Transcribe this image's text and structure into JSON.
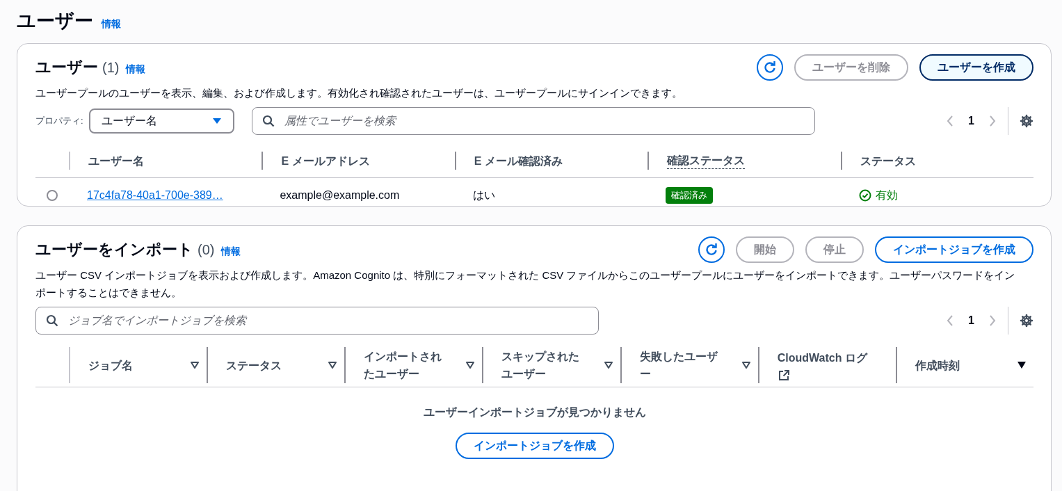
{
  "page": {
    "title": "ユーザー",
    "info": "情報"
  },
  "users": {
    "title": "ユーザー",
    "count": "(1)",
    "info": "情報",
    "buttons": [
      {
        "label": "ユーザーを削除",
        "disabled": true,
        "highlighted": false
      },
      {
        "label": "ユーザーを作成",
        "disabled": false,
        "highlighted": true
      }
    ],
    "description": "ユーザープールのユーザーを表示、編集、および作成します。有効化され確認されたユーザーは、ユーザープールにサインインできます。",
    "property_label": "プロパティ:",
    "property_value": "ユーザー名",
    "search": {
      "placeholder": "属性でユーザーを検索"
    },
    "pagination": {
      "page": "1",
      "prev_disabled": true,
      "next_disabled": true
    },
    "columns": [
      {
        "label": "ユーザー名",
        "kind": "plain"
      },
      {
        "label": "E メールアドレス",
        "kind": "plain"
      },
      {
        "label": "E メール確認済み",
        "kind": "plain"
      },
      {
        "label": "確認ステータス",
        "kind": "tooltip"
      },
      {
        "label": "ステータス",
        "kind": "plain"
      }
    ],
    "rows": [
      {
        "selected": false,
        "username": "17c4fa78-40a1-700e-389…",
        "email": "example@example.com",
        "email_verified": "はい",
        "confirmation": "確認済み",
        "status": "有効",
        "enabled": true
      }
    ]
  },
  "imports": {
    "title": "ユーザーをインポート",
    "count": "(0)",
    "info": "情報",
    "buttons": [
      {
        "label": "開始",
        "disabled": true,
        "highlighted": false
      },
      {
        "label": "停止",
        "disabled": true,
        "highlighted": false
      },
      {
        "label": "インポートジョブを作成",
        "disabled": false,
        "highlighted": false
      }
    ],
    "description": "ユーザー CSV インポートジョブを表示および作成します。Amazon Cognito は、特別にフォーマットされた CSV ファイルからこのユーザープールにユーザーをインポートできます。ユーザーパスワードをインポートすることはできません。",
    "search": {
      "placeholder": "ジョブ名でインポートジョブを検索"
    },
    "pagination": {
      "page": "1",
      "prev_disabled": true,
      "next_disabled": true
    },
    "columns": [
      {
        "label": "ジョブ名",
        "kind": "sortable"
      },
      {
        "label": "ステータス",
        "kind": "sortable"
      },
      {
        "label": "インポートされたユーザー",
        "kind": "sortable"
      },
      {
        "label": "スキップされたユーザー",
        "kind": "sortable"
      },
      {
        "label": "失敗したユーザー",
        "kind": "sortable"
      },
      {
        "label": "CloudWatch ログ",
        "kind": "external"
      },
      {
        "label": "作成時刻",
        "kind": "sorted"
      }
    ],
    "empty_text": "ユーザーインポートジョブが見つかりません",
    "empty_button": "インポートジョブを作成"
  }
}
